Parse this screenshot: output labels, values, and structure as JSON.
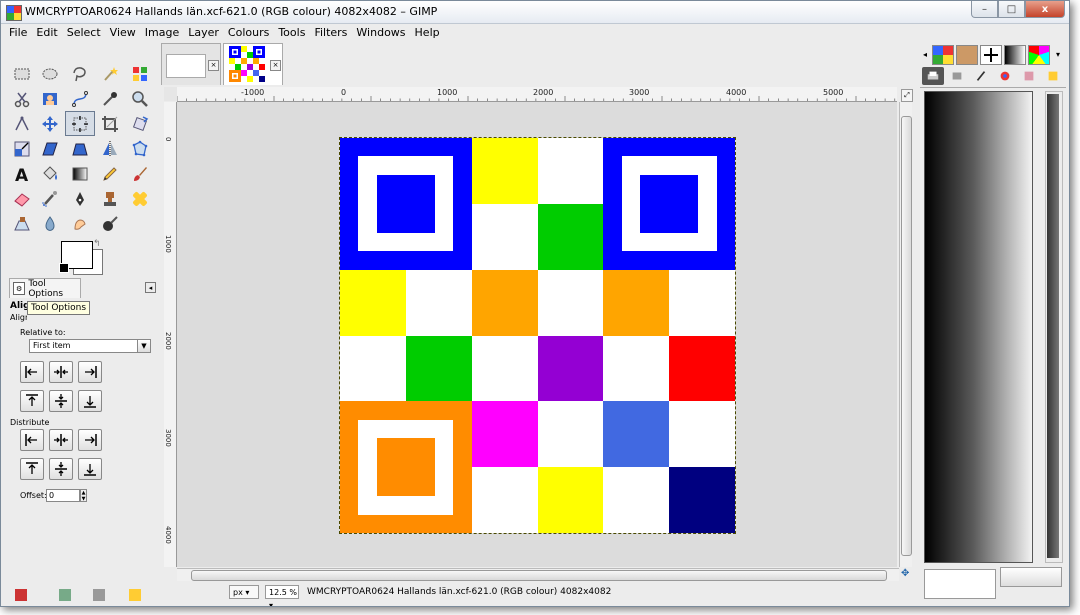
{
  "window": {
    "title": "WMCRYPTOAR0624 Hallands län.xcf-621.0 (RGB colour) 4082x4082 – GIMP",
    "controls": {
      "minimize": "–",
      "maximize": "□",
      "close": "x"
    }
  },
  "menubar": {
    "items": [
      "File",
      "Edit",
      "Select",
      "View",
      "Image",
      "Layer",
      "Colours",
      "Tools",
      "Filters",
      "Windows",
      "Help"
    ]
  },
  "toolbox": {
    "tools": [
      "rect-select",
      "ellipse-select",
      "free-select",
      "fuzzy-select",
      "select-by-color",
      "scissors-select",
      "foreground-select",
      "paths",
      "color-picker",
      "zoom",
      "measure",
      "move",
      "align",
      "crop",
      "rotate",
      "scale",
      "shear",
      "perspective",
      "flip",
      "cage",
      "text",
      "bucket-fill",
      "blend",
      "pencil",
      "paintbrush",
      "eraser",
      "airbrush",
      "ink",
      "clone",
      "heal",
      "perspective-clone",
      "blur",
      "smudge",
      "dodge-burn"
    ],
    "active_tool": "align",
    "foreground_color": "#ffffff",
    "background_color": "#ffffff"
  },
  "tool_options": {
    "tab_label": "Tool Options",
    "tooltip": "Tool Options",
    "heading": "Align",
    "subheading": "Align",
    "relative_to_label": "Relative to:",
    "relative_to_value": "First item",
    "distribute_label": "Distribute",
    "offset_label": "Offset:",
    "offset_value": "0"
  },
  "image_tabs": [
    {
      "name": "blank-image-tab",
      "active": false
    },
    {
      "name": "qr-image-tab",
      "active": true
    }
  ],
  "rulers": {
    "top_labels": [
      "-1000",
      "0",
      "1000",
      "2000",
      "3000",
      "4000",
      "5000"
    ],
    "left_labels": [
      "0",
      "1000",
      "2000",
      "3000",
      "4000"
    ]
  },
  "status": {
    "unit": "px",
    "zoom": "12.5 %",
    "text": "WMCRYPTOAR0624 Hallands län.xcf-621.0 (RGB colour) 4082x4082"
  },
  "image": {
    "grid_size": 6,
    "colors": {
      "B": "#0000ff",
      "W": "#ffffff",
      "Y": "#ffff00",
      "G": "#00cc00",
      "O": "#ffa500",
      "P": "#9400d3",
      "R": "#ff0000",
      "M": "#ff00ff",
      "L": "#4169e1",
      "N": "#000080",
      "D": "#ff8c00"
    },
    "cells": [
      [
        "F",
        "F",
        "Y",
        "W",
        "F",
        "F"
      ],
      [
        "F",
        "F",
        "W",
        "G",
        "F",
        "F"
      ],
      [
        "Y",
        "W",
        "O",
        "W",
        "O",
        "W"
      ],
      [
        "W",
        "G",
        "W",
        "P",
        "W",
        "R"
      ],
      [
        "F",
        "F",
        "M",
        "W",
        "L",
        "W"
      ],
      [
        "F",
        "F",
        "W",
        "Y",
        "W",
        "N"
      ]
    ],
    "finders": [
      {
        "row": 0,
        "col": 0,
        "outer": "#0000ff",
        "inner": "#0000ff"
      },
      {
        "row": 0,
        "col": 4,
        "outer": "#0000ff",
        "inner": "#0000ff"
      },
      {
        "row": 4,
        "col": 0,
        "outer": "#ff8c00",
        "inner": "#ff8c00"
      }
    ]
  }
}
